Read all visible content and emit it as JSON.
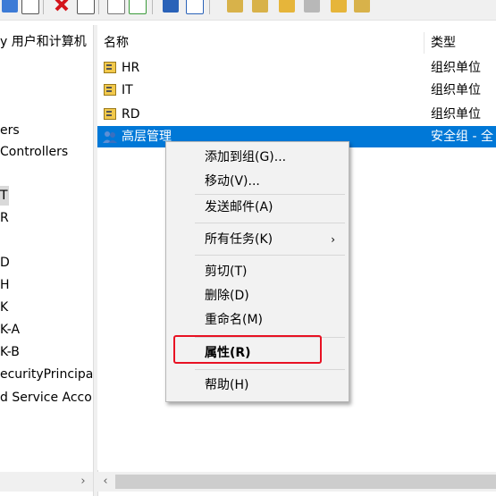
{
  "toolbar": {
    "icons": [
      "back-icon",
      "document-icon",
      "delete-icon",
      "properties-icon",
      "refresh-icon",
      "export-icon",
      "help-icon",
      "view-icon",
      "user-icon",
      "group-icon",
      "ou-icon",
      "filter-icon",
      "group-add-icon",
      "users-icon"
    ]
  },
  "tree": {
    "items": [
      {
        "label": "y 用户和计算机"
      },
      {
        "label": "ers"
      },
      {
        "label": "Controllers"
      },
      {
        "label": "T",
        "selected": true
      },
      {
        "label": "R"
      },
      {
        "label": "D"
      },
      {
        "label": "H"
      },
      {
        "label": "K"
      },
      {
        "label": "K-A"
      },
      {
        "label": "K-B"
      },
      {
        "label": "ecurityPrincipals"
      },
      {
        "label": "d Service Accounts"
      }
    ]
  },
  "list": {
    "columns": {
      "name": "名称",
      "type": "类型"
    },
    "rows": [
      {
        "name": "HR",
        "type": "组织单位",
        "icon": "ou-icon"
      },
      {
        "name": "IT",
        "type": "组织单位",
        "icon": "ou-icon"
      },
      {
        "name": "RD",
        "type": "组织单位",
        "icon": "ou-icon"
      },
      {
        "name": "高层管理",
        "type": "安全组 - 全",
        "icon": "group-icon",
        "selected": true
      }
    ]
  },
  "scrollbars": {
    "right_arrow": "›",
    "left_arrow": "‹"
  },
  "context_menu": {
    "items": [
      {
        "label": "添加到组(G)..."
      },
      {
        "label": "移动(V)..."
      },
      {
        "label": "发送邮件(A)"
      },
      {
        "label": "所有任务(K)",
        "submenu_arrow": "›"
      },
      {
        "label": "剪切(T)"
      },
      {
        "label": "删除(D)"
      },
      {
        "label": "重命名(M)"
      },
      {
        "label": "属性(R)",
        "bold": true,
        "highlighted": true
      },
      {
        "label": "帮助(H)"
      }
    ]
  },
  "colors": {
    "selection": "#0078d7",
    "highlight_border": "#e81123"
  }
}
